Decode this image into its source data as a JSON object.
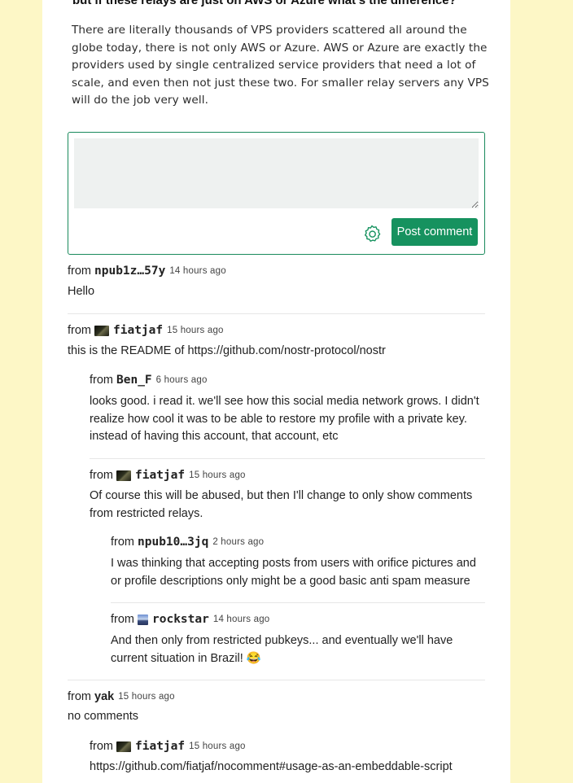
{
  "article": {
    "heading": "but if these relays are just on AWS or Azure what's the difference?",
    "paragraph": "There are literally thousands of VPS providers scattered all around the globe today, there is not only AWS or Azure. AWS or Azure are exactly the providers used by single centralized service providers that need a lot of scale, and even then not just these two. For smaller relay servers any VPS will do the job very well."
  },
  "comment_form": {
    "textarea_value": "",
    "settings_icon": "gear-icon",
    "post_label": "Post comment",
    "accent_color": "#16925f"
  },
  "comments": [
    {
      "from": "from",
      "author": "npub1z…57y",
      "time": "14 hours ago",
      "text": "Hello"
    },
    {
      "from": "from",
      "author": "fiatjaf",
      "time": "15 hours ago",
      "text": "this is the README of https://github.com/nostr-protocol/nostr"
    },
    {
      "from": "from",
      "author": "Ben_F",
      "time": "6 hours ago",
      "text": "looks good. i read it. we'll see how this social media network grows. I didn't realize how cool it was to be able to restore my profile with a private key. instead of having this account, that account, etc"
    },
    {
      "from": "from",
      "author": "fiatjaf",
      "time": "15 hours ago",
      "text": "Of course this will be abused, but then I'll change to only show comments from restricted relays."
    },
    {
      "from": "from",
      "author": "npub10…3jq",
      "time": "2 hours ago",
      "text": "I was thinking that accepting posts from users with orifice pictures and or profile descriptions only might be a good basic anti spam measure"
    },
    {
      "from": "from",
      "author": "rockstar",
      "time": "14 hours ago",
      "text": "And then only from restricted pubkeys... and eventually we'll have current situation in Brazil! 😂"
    },
    {
      "from": "from",
      "author": "yak",
      "time": "15 hours ago",
      "text": "no comments"
    },
    {
      "from": "from",
      "author": "fiatjaf",
      "time": "15 hours ago",
      "text": "https://github.com/fiatjaf/nocomment#usage-as-an-embeddable-script"
    }
  ]
}
